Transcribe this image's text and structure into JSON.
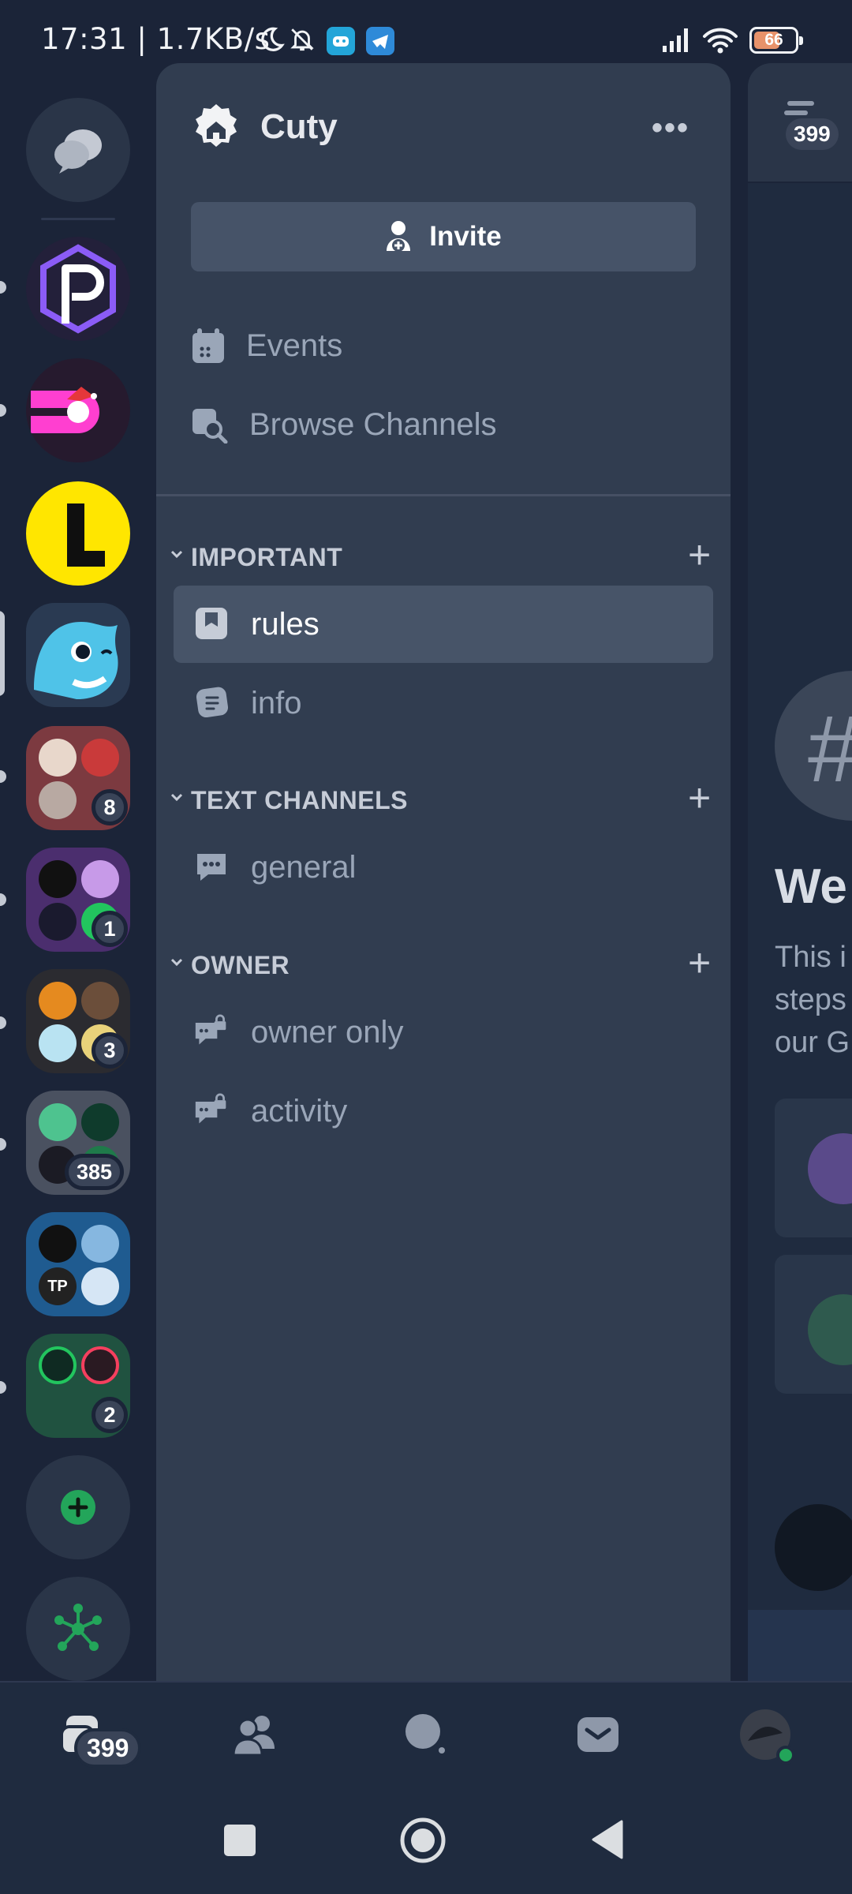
{
  "status_bar": {
    "time": "17:31 | 1.7KB/s",
    "battery": "66"
  },
  "server_rail": {
    "folder_badges": {
      "folder1": "8",
      "folder2": "1",
      "folder3": "3",
      "folder4": "385",
      "folder6": "2"
    },
    "mini_texts": {
      "tp": "TP"
    }
  },
  "guild": {
    "name": "Cuty",
    "invite_label": "Invite",
    "menu": {
      "events": "Events",
      "browse": "Browse Channels"
    },
    "categories": {
      "important": {
        "label": "IMPORTANT",
        "channels": [
          "rules",
          "info"
        ]
      },
      "text": {
        "label": "TEXT CHANNELS",
        "channels": [
          "general"
        ]
      },
      "owner": {
        "label": "OWNER",
        "channels": [
          "owner only",
          "activity"
        ]
      }
    }
  },
  "peek": {
    "badge": "399",
    "welcome": "We",
    "line1": "This i",
    "line2": "steps",
    "line3": "our G"
  },
  "bottom_nav": {
    "home_badge": "399"
  },
  "colors": {
    "rail_bg": "#1b2438",
    "panel_bg": "#313d50",
    "active_channel": "#475468",
    "brand_green": "#23a55a"
  }
}
